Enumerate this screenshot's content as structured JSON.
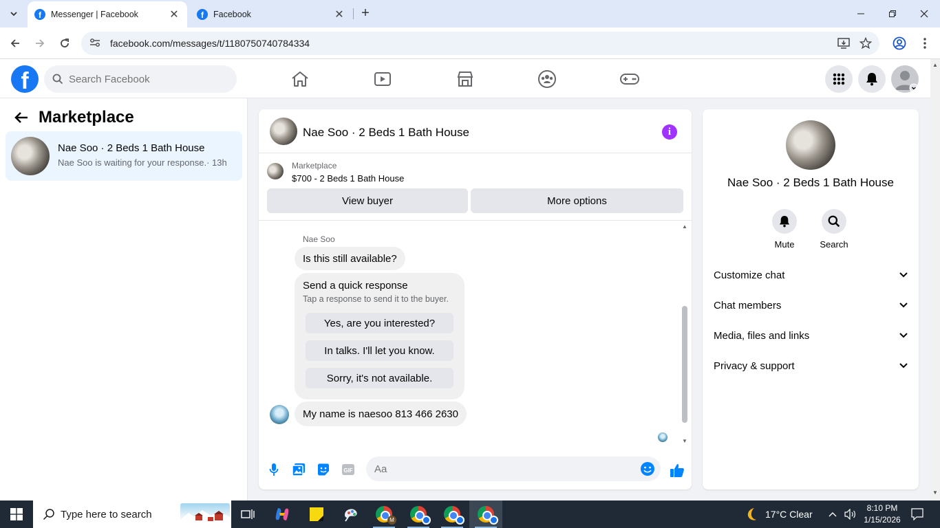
{
  "browser": {
    "tabs": [
      {
        "title": "Messenger | Facebook",
        "active": true
      },
      {
        "title": "Facebook",
        "active": false
      }
    ],
    "url": "facebook.com/messages/t/1180750740784334"
  },
  "fb": {
    "search_placeholder": "Search Facebook"
  },
  "left": {
    "title": "Marketplace",
    "conversations": [
      {
        "name": "Nae Soo · 2 Beds 1 Bath House",
        "preview": "Nae Soo is waiting for your response.",
        "time": "· 13h"
      }
    ]
  },
  "chat": {
    "title": "Nae Soo · 2 Beds 1 Bath House",
    "listing": {
      "label": "Marketplace",
      "price_title": "$700 - 2 Beds 1 Bath House",
      "view_buyer": "View buyer",
      "more_options": "More options"
    },
    "sender": "Nae Soo",
    "messages": [
      "Is this still available?",
      "My name is naesoo 813 466 2630"
    ],
    "quick_response": {
      "title": "Send a quick response",
      "subtitle": "Tap a response to send it to the buyer.",
      "options": [
        "Yes, are you interested?",
        "In talks. I'll let you know.",
        "Sorry, it's not available."
      ]
    },
    "composer_placeholder": "Aa"
  },
  "right": {
    "name": "Nae Soo · 2 Beds 1 Bath House",
    "actions": [
      "Mute",
      "Search"
    ],
    "sections": [
      "Customize chat",
      "Chat members",
      "Media, files and links",
      "Privacy & support"
    ]
  },
  "taskbar": {
    "search_placeholder": "Type here to search",
    "weather": "17°C  Clear",
    "time": "8:10 PM",
    "date": "1/15/2026"
  },
  "colors": {
    "fb_blue": "#1877f2",
    "messenger_purple": "#a033ff",
    "active_convo_bg": "#ebf5ff"
  }
}
